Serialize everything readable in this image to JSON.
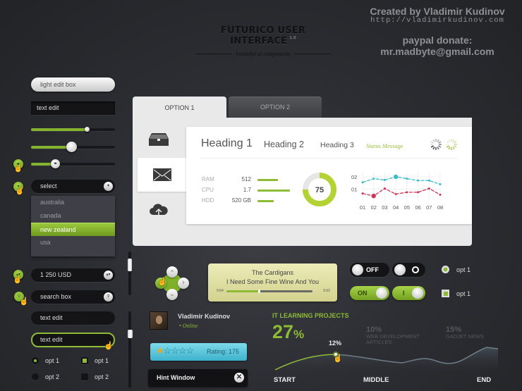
{
  "header": {
    "title": "FUTURICO USER INTERFACE",
    "version": "1.0",
    "subtitle": "beautiful ui components",
    "credit": "Created by Vladimir Kudinov",
    "credit_url": "http://vladimirkudinov.com",
    "donate_label": "paypal donate:",
    "donate_email": "mr.madbyte@gmail.com"
  },
  "left": {
    "light_edit_box": "light edit box",
    "text_edit_square": "text edit",
    "sliders": [
      {
        "value_pct": 67
      },
      {
        "value_pct": 48
      },
      {
        "value_pct": 29
      }
    ],
    "select": {
      "label": "select",
      "options": [
        "australia",
        "canada",
        "new zealand",
        "usa"
      ],
      "selected": "new zealand"
    },
    "currency_stepper": "1 250 USD",
    "search_box": "search box",
    "text_edit_1": "text edit",
    "text_edit_2": "text edit",
    "radios": [
      {
        "label": "opt 1",
        "checked": true
      },
      {
        "label": "opt 2",
        "checked": false
      }
    ],
    "checks": [
      {
        "label": "opt 1",
        "checked": true
      },
      {
        "label": "opt 2",
        "checked": false
      }
    ]
  },
  "icons": {
    "hand": "☝",
    "arrow_lr": "◂▸",
    "arrow_down": "▾",
    "arrow_ud": "▴▾",
    "search": "⚲",
    "close": "✕",
    "up": "⌃",
    "down": "⌄",
    "left": "‹",
    "right": "›"
  },
  "tabs": {
    "items": [
      {
        "label": "OPTION 1",
        "active": true
      },
      {
        "label": "OPTION 2",
        "active": false
      }
    ],
    "side_icons": [
      "inbox-icon",
      "mail-icon",
      "cloud-upload-icon"
    ],
    "heading1": "Heading 1",
    "heading2": "Heading 2",
    "heading3": "Heading 3",
    "status_message": "Status Message",
    "stats": [
      {
        "label": "RAM",
        "value": "512",
        "bar_pct": 60
      },
      {
        "label": "CPU",
        "value": "1.7",
        "bar_pct": 95
      },
      {
        "label": "HDD",
        "value": "520 GB",
        "bar_pct": 47
      }
    ],
    "donut": {
      "value": "75",
      "percent": 75
    }
  },
  "chart_data": {
    "type": "line",
    "x": [
      "01",
      "02",
      "03",
      "04",
      "05",
      "06",
      "07",
      "08"
    ],
    "y_ticks": [
      "01",
      "02"
    ],
    "ylim": [
      0,
      2.4
    ],
    "series": [
      {
        "name": "cyan",
        "color": "#3bbcc9",
        "values": [
          1.55,
          1.85,
          1.75,
          2.0,
          1.85,
          1.7,
          1.7,
          1.4
        ],
        "highlight_index": 3
      },
      {
        "name": "red",
        "color": "#cc3355",
        "values": [
          0.65,
          0.45,
          1.05,
          0.6,
          0.75,
          0.75,
          1.05,
          0.55
        ],
        "highlight_index": 1
      }
    ]
  },
  "player": {
    "artist": "The Cardigans",
    "song": "I Need Some Fine Wine And You",
    "elapsed": "0:54",
    "total": "5:02",
    "progress_pct": 38
  },
  "toggles": {
    "off_label": "OFF",
    "o_label": "O",
    "on_label": "ON",
    "i_label": "I",
    "radio_label": "opt 1",
    "check_label": "opt 1"
  },
  "profile": {
    "name": "Vladimir Kudinov",
    "status": "Online"
  },
  "rating": {
    "stars_filled": 1,
    "stars_total": 5,
    "label": "Rating: 175"
  },
  "hint": {
    "label": "Hint Window"
  },
  "learning": {
    "title": "IT LEARNING PROJECTS",
    "main_value": "27",
    "main_unit": "%",
    "items": [
      {
        "value": "10%",
        "label_line1": "WEB DEVELOPMENT",
        "label_line2": "ARTICLES"
      },
      {
        "value": "15%",
        "label_line1": "GADJET NEWS",
        "label_line2": ""
      }
    ],
    "point_label": "12%",
    "axis": [
      "START",
      "MIDDLE",
      "END"
    ]
  },
  "colors": {
    "accent_green": "#8dbb36",
    "cyan": "#3bbcc9",
    "red": "#cc3355",
    "dark_field": "#141416"
  }
}
